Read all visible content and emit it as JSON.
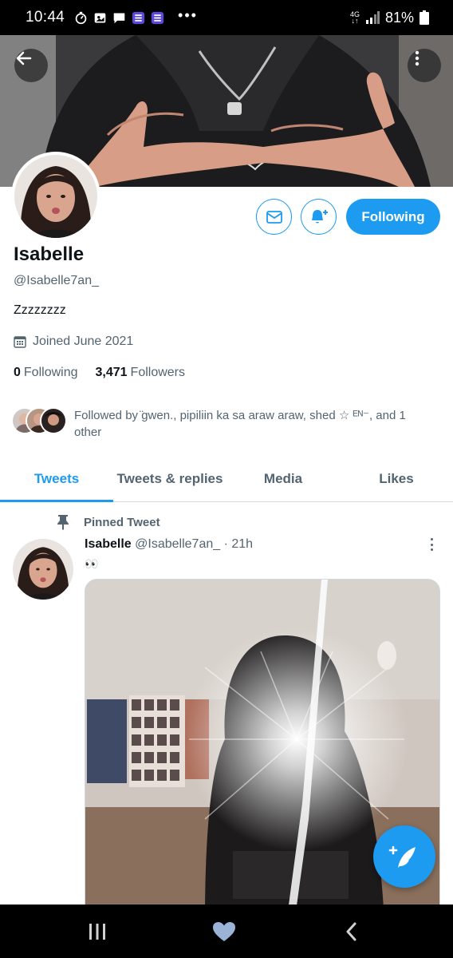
{
  "status_bar": {
    "time": "10:44",
    "battery": "81%",
    "network": "4G",
    "icons": [
      "timer-icon",
      "photo-icon",
      "message-icon",
      "list-icon",
      "list-icon",
      "more-dots-icon",
      "signal-icon",
      "battery-icon"
    ]
  },
  "header": {
    "back_icon": "arrow-left-icon",
    "more_icon": "more-vertical-icon"
  },
  "profile": {
    "name": "Isabelle",
    "handle": "@Isabelle7an_",
    "bio": "Zzzzzzzz",
    "joined": "Joined June 2021",
    "following_count": "0",
    "following_label": "Following",
    "followers_count": "3,471",
    "followers_label": "Followers",
    "followed_by": "Followed by ̈gwen., pipiliin ka sa araw araw, shed ☆ ᴱᴺ⁻, and 1 other",
    "following_button": "Following"
  },
  "tabs": [
    {
      "label": "Tweets",
      "active": true
    },
    {
      "label": "Tweets & replies",
      "active": false
    },
    {
      "label": "Media",
      "active": false
    },
    {
      "label": "Likes",
      "active": false
    }
  ],
  "tweet": {
    "pinned_label": "Pinned Tweet",
    "author": "Isabelle",
    "handle": "@Isabelle7an_",
    "time": "· 21h",
    "text": "👀"
  },
  "colors": {
    "accent": "#1d9bf0",
    "secondary_text": "#536471",
    "primary_text": "#0f1419"
  }
}
